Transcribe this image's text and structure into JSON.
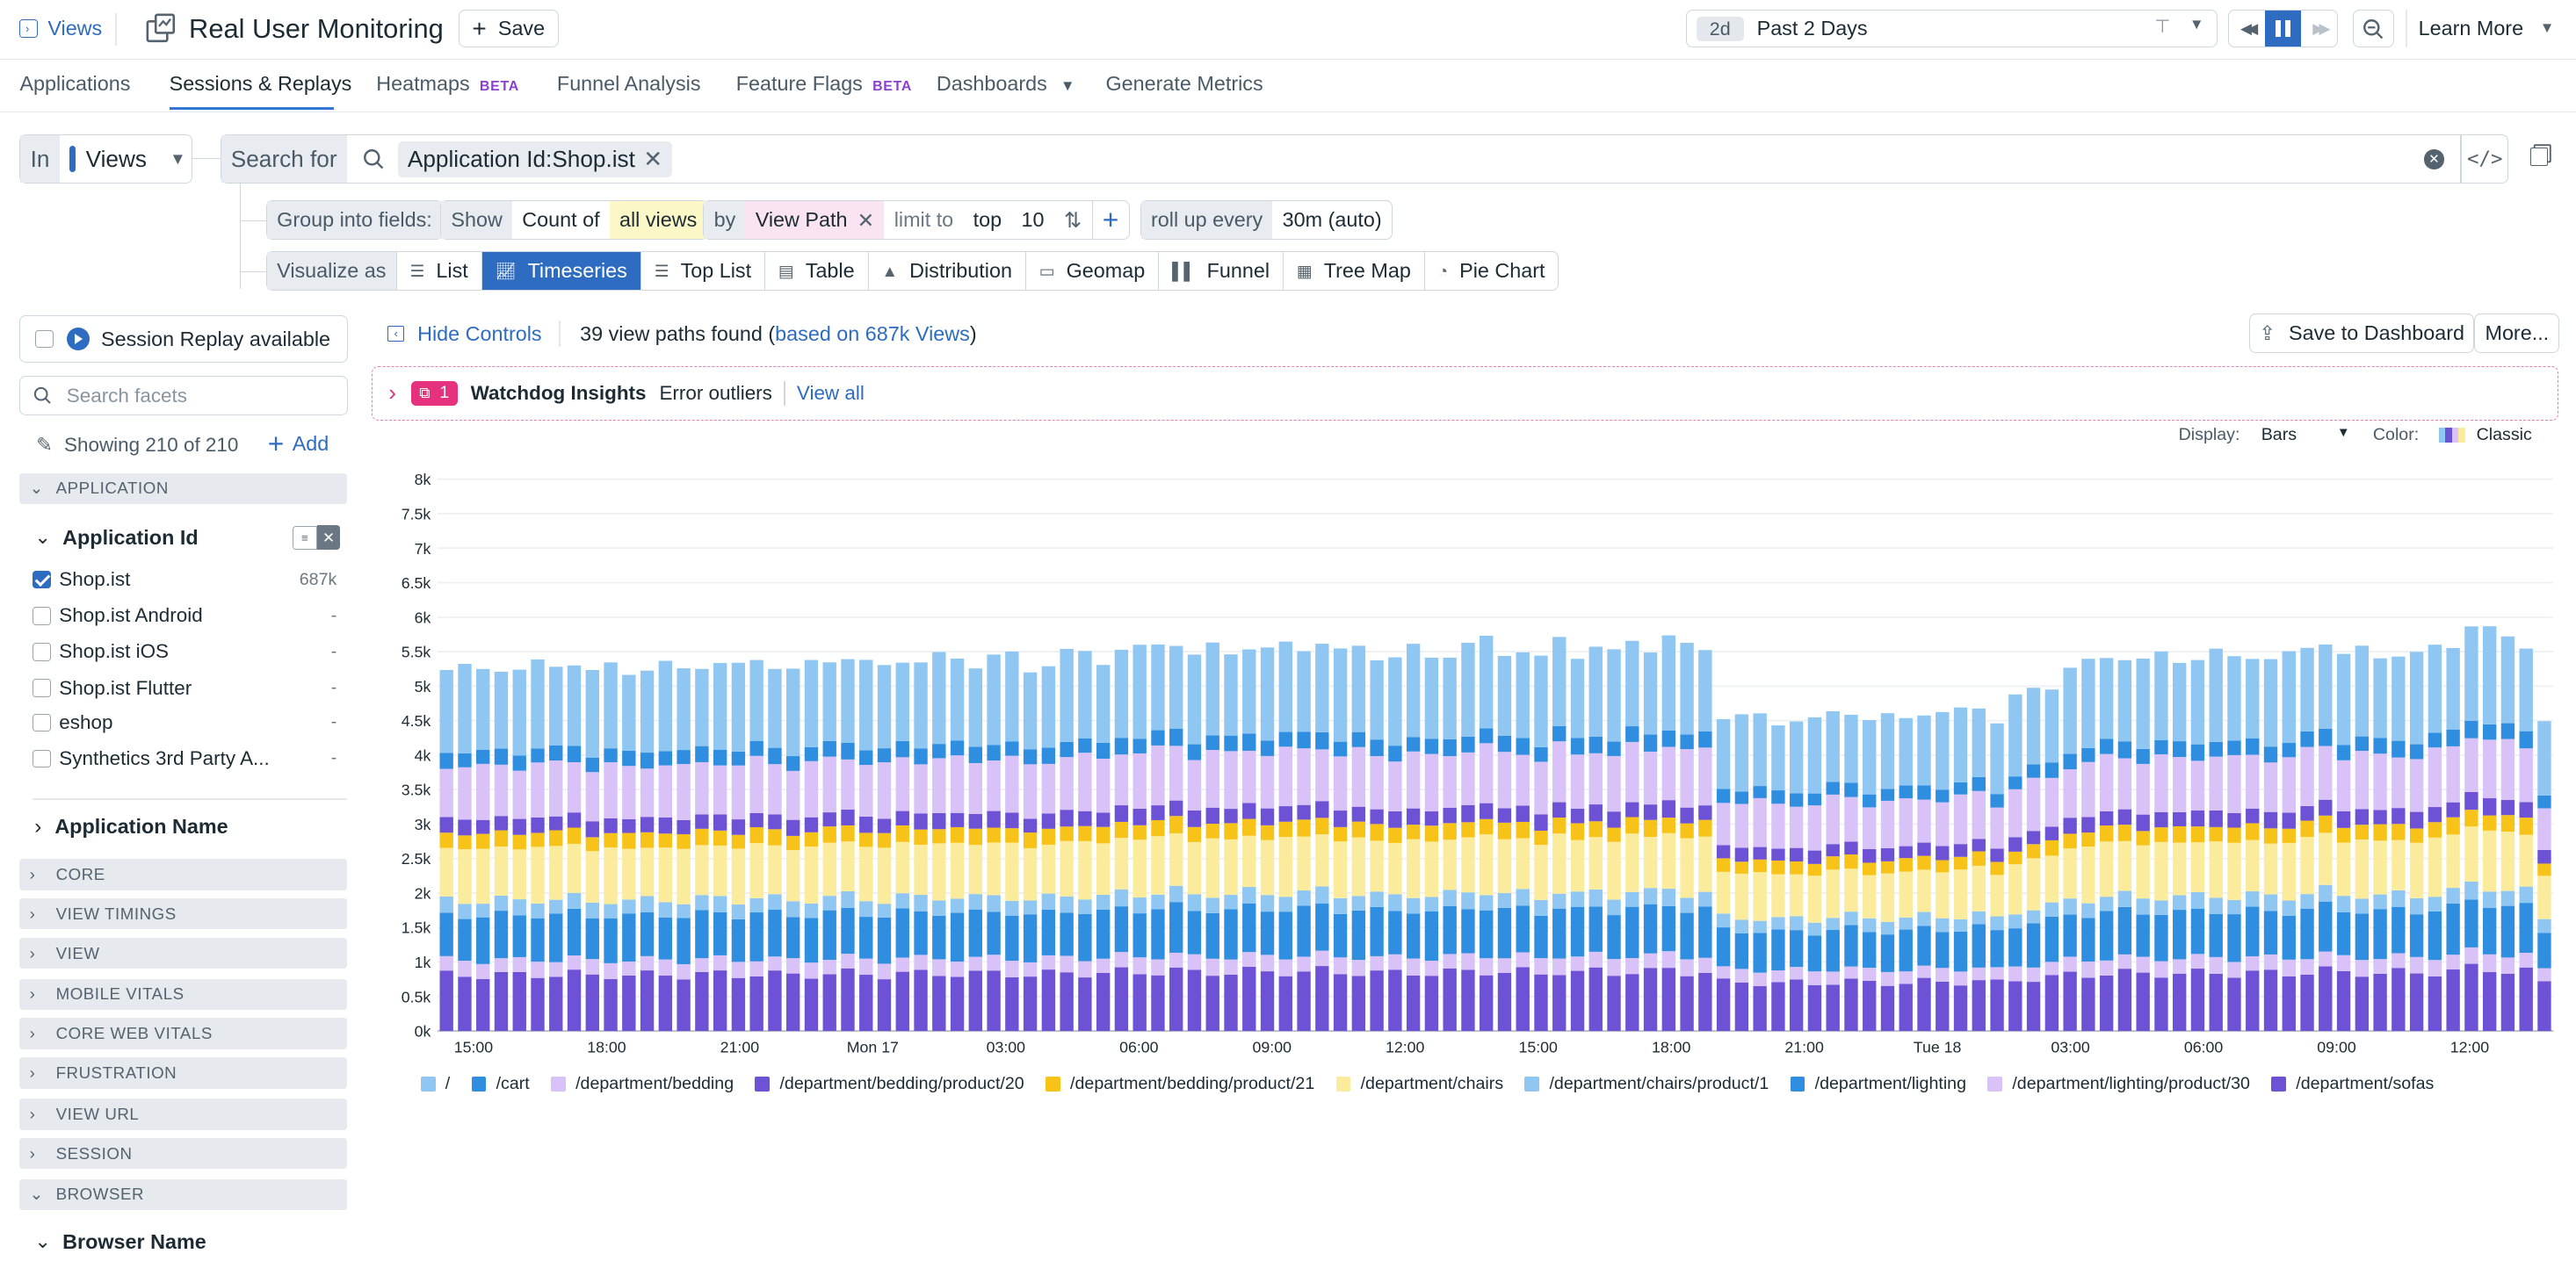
{
  "topbar": {
    "views_label": "Views",
    "title": "Real User Monitoring",
    "save_label": "Save",
    "time_badge": "2d",
    "time_range": "Past 2 Days",
    "learn_more": "Learn More"
  },
  "tabs": [
    {
      "label": "Applications"
    },
    {
      "label": "Sessions & Replays"
    },
    {
      "label": "Heatmaps",
      "badge": "BETA"
    },
    {
      "label": "Funnel Analysis"
    },
    {
      "label": "Feature Flags",
      "badge": "BETA"
    },
    {
      "label": "Dashboards"
    },
    {
      "label": "Generate Metrics"
    }
  ],
  "query": {
    "in_label": "In",
    "source": "Views",
    "search_for": "Search for",
    "filter_chip": "Application Id:Shop.ist"
  },
  "group": {
    "label": "Group into fields:",
    "show": "Show",
    "count_of": "Count of",
    "all_views": "all views",
    "by": "by",
    "field": "View Path",
    "limit_to": "limit to",
    "top": "top",
    "limit": "10",
    "rollup": "roll up every",
    "interval": "30m (auto)"
  },
  "visualize": {
    "label": "Visualize as",
    "options": [
      "List",
      "Timeseries",
      "Top List",
      "Table",
      "Distribution",
      "Geomap",
      "Funnel",
      "Tree Map",
      "Pie Chart"
    ],
    "active": "Timeseries"
  },
  "sidebar": {
    "session_replay": "Session Replay available",
    "search_placeholder": "Search facets",
    "showing": "Showing 210 of 210",
    "add": "Add",
    "sections": {
      "application": "APPLICATION",
      "app_id": "Application Id",
      "app_name": "Application Name",
      "core": "CORE",
      "view_timings": "VIEW TIMINGS",
      "view": "VIEW",
      "mobile_vitals": "MOBILE VITALS",
      "core_web_vitals": "CORE WEB VITALS",
      "frustration": "FRUSTRATION",
      "view_url": "VIEW URL",
      "session": "SESSION",
      "browser": "BROWSER",
      "browser_name": "Browser Name"
    },
    "app_ids": [
      {
        "name": "Shop.ist",
        "count": "687k",
        "checked": true
      },
      {
        "name": "Shop.ist Android",
        "count": "-",
        "checked": false
      },
      {
        "name": "Shop.ist iOS",
        "count": "-",
        "checked": false
      },
      {
        "name": "Shop.ist Flutter",
        "count": "-",
        "checked": false
      },
      {
        "name": "eshop",
        "count": "-",
        "checked": false
      },
      {
        "name": "Synthetics 3rd Party A...",
        "count": "-",
        "checked": false
      }
    ]
  },
  "results": {
    "hide_controls": "Hide Controls",
    "found": "39 view paths found (",
    "based_on": "based on 687k Views",
    "found_end": ")",
    "save_dashboard": "Save to Dashboard",
    "more": "More..."
  },
  "watchdog": {
    "count": "1",
    "title": "Watchdog Insights",
    "desc": "Error outliers",
    "view_all": "View all"
  },
  "display": {
    "display_label": "Display:",
    "display_value": "Bars",
    "color_label": "Color:",
    "color_value": "Classic"
  },
  "chart_data": {
    "type": "bar",
    "stacked": true,
    "y_ticks": [
      "0k",
      "0.5k",
      "1k",
      "1.5k",
      "2k",
      "2.5k",
      "3k",
      "3.5k",
      "4k",
      "4.5k",
      "5k",
      "5.5k",
      "6k",
      "6.5k",
      "7k",
      "7.5k",
      "8k"
    ],
    "ylim": [
      0,
      8000
    ],
    "x_ticks": [
      "15:00",
      "18:00",
      "21:00",
      "Mon 17",
      "03:00",
      "06:00",
      "09:00",
      "12:00",
      "15:00",
      "18:00",
      "21:00",
      "Tue 18",
      "03:00",
      "06:00",
      "09:00",
      "12:00"
    ],
    "bar_count": 96,
    "series": [
      {
        "name": "/",
        "color": "#8fc7f2",
        "share": 0.222
      },
      {
        "name": "/cart",
        "color": "#2f8ee0",
        "share": 0.04
      },
      {
        "name": "/department/bedding",
        "color": "#d8c2f7",
        "share": 0.14
      },
      {
        "name": "/department/bedding/product/20",
        "color": "#6d52d6",
        "share": 0.04
      },
      {
        "name": "/department/bedding/product/21",
        "color": "#f8c318",
        "share": 0.04
      },
      {
        "name": "/department/chairs",
        "color": "#fbeb9c",
        "share": 0.14
      },
      {
        "name": "/department/chairs/product/1",
        "color": "#8fc7f2",
        "share": 0.04
      },
      {
        "name": "/department/lighting",
        "color": "#2f8ee0",
        "share": 0.12
      },
      {
        "name": "/department/lighting/product/30",
        "color": "#d8c2f7",
        "share": 0.04
      },
      {
        "name": "/department/sofas",
        "color": "#6d52d6",
        "share": 0.15
      }
    ],
    "totals": [
      5420,
      5410,
      5380,
      5430,
      5390,
      5470,
      5450,
      5520,
      5350,
      5440,
      5360,
      5420,
      5460,
      5380,
      5470,
      5500,
      5420,
      5540,
      5470,
      5380,
      5470,
      5540,
      5600,
      5480,
      5420,
      5560,
      5520,
      5580,
      5550,
      5480,
      5600,
      5590,
      5380,
      5500,
      5650,
      5620,
      5520,
      5720,
      5690,
      5750,
      5820,
      5610,
      5720,
      5640,
      5760,
      5680,
      5750,
      5720,
      5820,
      5640,
      5720,
      5600,
      5580,
      5700,
      5580,
      5640,
      5760,
      5830,
      5640,
      5700,
      5540,
      5840,
      5620,
      5750,
      5620,
      5820,
      5720,
      5880,
      5720,
      5720,
      4700,
      4680,
      4700,
      4610,
      4640,
      4620,
      4760,
      4780,
      4630,
      4680,
      4690,
      4760,
      4720,
      4780,
      4860,
      4620,
      4960,
      5100,
      5160,
      5420,
      5480,
      5580,
      5600,
      5520,
      5600,
      5540,
      5580,
      5640,
      5560,
      5620,
      5560,
      5590,
      5720,
      5840,
      5600,
      5680,
      5600,
      5640,
      5600,
      5720,
      5780,
      6060,
      5960,
      5880,
      5780,
      4610
    ]
  }
}
